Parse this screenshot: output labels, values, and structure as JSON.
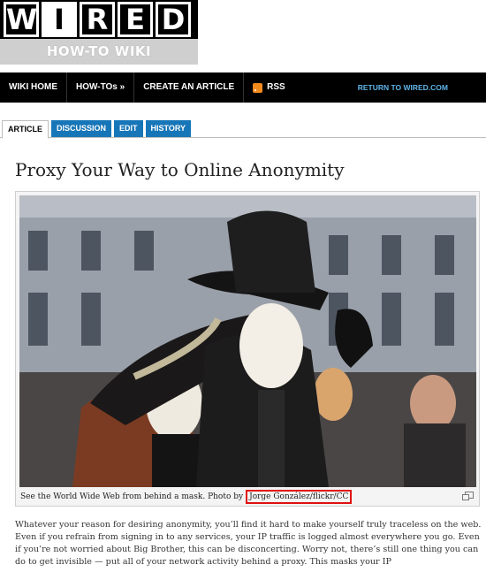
{
  "logo": {
    "letters": [
      "W",
      "I",
      "R",
      "E",
      "D"
    ],
    "subtitle": "HOW-TO WIKI"
  },
  "nav": {
    "items": [
      {
        "label": "WIKI HOME"
      },
      {
        "label": "HOW-TOs »"
      },
      {
        "label": "CREATE AN ARTICLE"
      },
      {
        "label": "RSS"
      }
    ],
    "return_link": "RETURN TO WIRED.COM"
  },
  "tabs": [
    {
      "label": "ARTICLE",
      "active": true
    },
    {
      "label": "DISCUSSION",
      "active": false
    },
    {
      "label": "EDIT",
      "active": false
    },
    {
      "label": "HISTORY",
      "active": false
    }
  ],
  "article": {
    "title": "Proxy Your Way to Online Anonymity",
    "caption_text": "See the World Wide Web from behind a mask. Photo by",
    "caption_credit": "Jorge González/flickr/CC",
    "body": "Whatever your reason for desiring anonymity, you’ll find it hard to make yourself truly traceless on the web. Even if you refrain from signing in to any services, your IP traffic is logged almost everywhere you go. Even if you’re not worried about Big Brother, this can be disconcerting. Worry not, there’s still one thing you can do to get invisible — put all of your network activity behind a proxy. This masks your IP"
  },
  "colors": {
    "tab_blue": "#1776b8",
    "nav_bg": "#000000",
    "return_link": "#5fb4e8",
    "credit_border": "#e01010",
    "rss": "#f28a1c"
  }
}
